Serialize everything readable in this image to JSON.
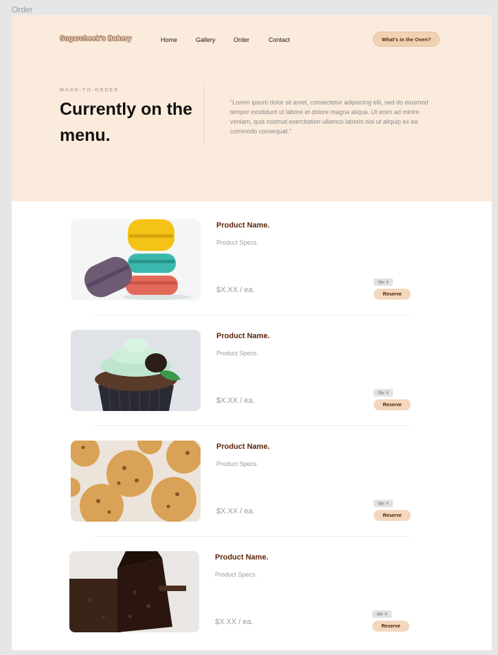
{
  "frame_label": "Order",
  "header": {
    "logo": "Sugarcheek's Bakery",
    "nav": [
      "Home",
      "Gallery",
      "Order",
      "Contact"
    ],
    "cta_label": "What's in the Oven?"
  },
  "hero": {
    "eyebrow": "MADE-TO-ORDER",
    "headline": "Currently on the menu.",
    "quote": "\"Lorem ipsum dolor sit amet, consectetur adipiscing elit, sed do eiusmod tempor incididunt ut labore et dolore magna aliqua. Ut enim ad minim veniam, quis nostrud exercitation ullamco laboris nisi ut aliquip ex ea commodo consequat.\""
  },
  "products": [
    {
      "image": "macarons-photo",
      "name": "Product Name.",
      "specs": "Product Specs.",
      "price": "$X.XX / ea.",
      "qty": "Qty: X",
      "action": "Reserve"
    },
    {
      "image": "cupcake-photo",
      "name": "Product Name.",
      "specs": "Product Specs.",
      "price": "$X.XX / ea.",
      "qty": "Qty: X",
      "action": "Reserve"
    },
    {
      "image": "cookies-photo",
      "name": "Product Name.",
      "specs": "Product Specs.",
      "price": "$X.XX / ea.",
      "qty": "Qty: X",
      "action": "Reserve"
    },
    {
      "image": "brownies-photo",
      "name": "Product Name.",
      "specs": "Product Specs.",
      "price": "$X.XX / ea.",
      "qty": "Qty: X",
      "action": "Reserve"
    }
  ],
  "colors": {
    "hero_bg": "#fbebdc",
    "accent": "#f3d8bd",
    "product_name": "#5a2508"
  }
}
